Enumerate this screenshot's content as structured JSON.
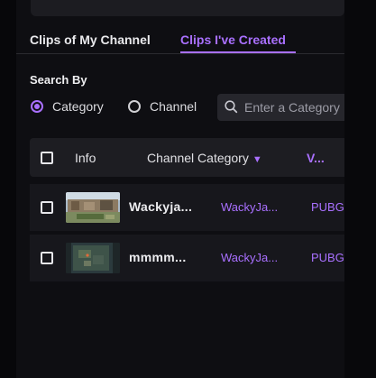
{
  "tabs": [
    {
      "label": "Clips of My Channel",
      "active": false
    },
    {
      "label": "Clips I've Created",
      "active": true
    }
  ],
  "search": {
    "heading": "Search By",
    "options": [
      {
        "label": "Category",
        "selected": true
      },
      {
        "label": "Channel",
        "selected": false
      }
    ],
    "placeholder": "Enter a Category"
  },
  "table": {
    "headers": {
      "info": "Info",
      "category": "Channel Category",
      "next": "V..."
    },
    "rows": [
      {
        "title": "Wackyja...",
        "channel": "WackyJa...",
        "game": "PUBG"
      },
      {
        "title": "mmmm...",
        "channel": "WackyJa...",
        "game": "PUBG"
      }
    ]
  },
  "colors": {
    "accent": "#a970ff",
    "background": "#0e0e12",
    "header": "#1d1d22",
    "row": "#17171c"
  },
  "icons": {
    "search": "search-icon",
    "sort": "chevron-down-icon"
  }
}
